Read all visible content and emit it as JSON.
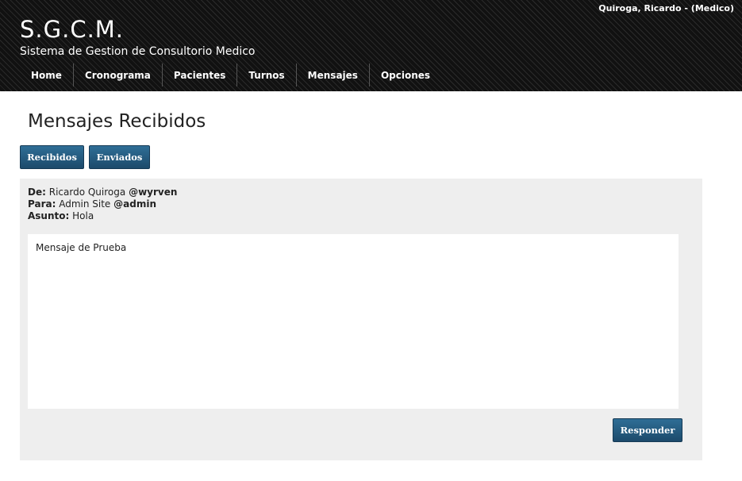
{
  "header": {
    "user": "Quiroga, Ricardo - (Medico)",
    "title": "S.G.C.M.",
    "subtitle": "Sistema de Gestion de Consultorio Medico"
  },
  "nav": {
    "items": [
      {
        "label": "Home"
      },
      {
        "label": "Cronograma"
      },
      {
        "label": "Pacientes"
      },
      {
        "label": "Turnos"
      },
      {
        "label": "Mensajes"
      },
      {
        "label": "Opciones"
      }
    ]
  },
  "page": {
    "title": "Mensajes Recibidos",
    "tabs": {
      "recibidos": "Recibidos",
      "enviados": "Enviados"
    }
  },
  "message": {
    "from_label": "De:",
    "from_name": "Ricardo Quiroga",
    "from_handle": "@wyrven",
    "to_label": "Para:",
    "to_name": "Admin Site",
    "to_handle": "@admin",
    "subject_label": "Asunto:",
    "subject": "Hola",
    "body": "Mensaje de Prueba",
    "reply_label": "Responder"
  }
}
